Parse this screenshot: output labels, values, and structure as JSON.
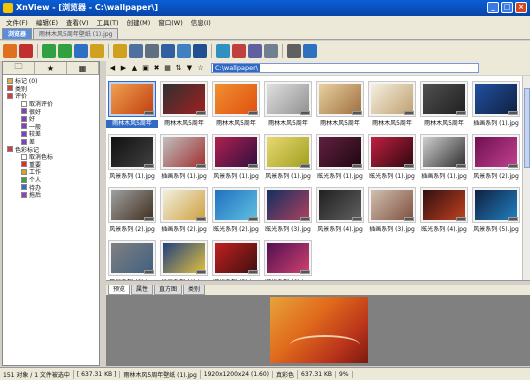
{
  "window": {
    "title": "XnView - [浏览器 - C:\\wallpaper\\]"
  },
  "menu": [
    "文件(F)",
    "编辑(E)",
    "查看(V)",
    "工具(T)",
    "创建(M)",
    "窗口(W)",
    "信息(I)"
  ],
  "tabs": [
    {
      "label": "浏览器"
    },
    {
      "label": "雨林木风5周年壁纸 (1).jpg"
    }
  ],
  "toolbar_icons": [
    "browse-icon",
    "fullscreen-icon",
    "refresh-icon",
    "forward-icon",
    "back-icon",
    "rotate-icon",
    "folder-icon",
    "copy-icon",
    "print-icon",
    "scan-icon",
    "mail-icon",
    "slideshow-icon",
    "web-icon",
    "capture-icon",
    "batch-icon",
    "convert-icon",
    "settings-icon",
    "help-icon"
  ],
  "path": {
    "value": "C:\\wallpaper\\"
  },
  "tree": [
    {
      "label": "标记 (0)",
      "indent": 1,
      "color": "#e0b040"
    },
    {
      "label": "类别",
      "indent": 1,
      "color": "#d04040"
    },
    {
      "label": "评价",
      "indent": 1,
      "color": "#d04040"
    },
    {
      "label": "取消评价",
      "indent": 2,
      "color": "#ffffff"
    },
    {
      "label": "很好",
      "indent": 2,
      "color": "#8040c0"
    },
    {
      "label": "好",
      "indent": 2,
      "color": "#8040c0"
    },
    {
      "label": "一般",
      "indent": 2,
      "color": "#8040c0"
    },
    {
      "label": "较差",
      "indent": 2,
      "color": "#8040c0"
    },
    {
      "label": "差",
      "indent": 2,
      "color": "#8040c0"
    },
    {
      "label": "色彩标记",
      "indent": 1,
      "color": "#d04040"
    },
    {
      "label": "取消色标",
      "indent": 2,
      "color": "#ffffff"
    },
    {
      "label": "重要",
      "indent": 2,
      "color": "#e03020"
    },
    {
      "label": "工作",
      "indent": 2,
      "color": "#e0a020"
    },
    {
      "label": "个人",
      "indent": 2,
      "color": "#40a040"
    },
    {
      "label": "待办",
      "indent": 2,
      "color": "#3070d0"
    },
    {
      "label": "拖后",
      "indent": 2,
      "color": "#9040c0"
    }
  ],
  "thumbnails": [
    {
      "caption": "雨林木风5周年",
      "colors": [
        "#f0a050",
        "#c04010"
      ]
    },
    {
      "caption": "雨林木风5周年",
      "colors": [
        "#303030",
        "#a02020"
      ]
    },
    {
      "caption": "雨林木风5周年",
      "colors": [
        "#f09030",
        "#e05010"
      ]
    },
    {
      "caption": "雨林木风5周年",
      "colors": [
        "#e0e0e0",
        "#909090"
      ]
    },
    {
      "caption": "雨林木风5周年",
      "colors": [
        "#e8d0a0",
        "#a07040"
      ]
    },
    {
      "caption": "雨林木风5周年",
      "colors": [
        "#f4f0e0",
        "#c0a070"
      ]
    },
    {
      "caption": "雨林木风5周年",
      "colors": [
        "#505050",
        "#202020"
      ]
    },
    {
      "caption": "插画系列 (1).jpg",
      "colors": [
        "#2050a0",
        "#102040"
      ]
    },
    {
      "caption": "风景系列 (1).jpg",
      "colors": [
        "#101010",
        "#404040"
      ]
    },
    {
      "caption": "插画系列 (1).jpg",
      "colors": [
        "#c0c0c0",
        "#a03030"
      ]
    },
    {
      "caption": "风景系列 (1).jpg",
      "colors": [
        "#b02050",
        "#301040"
      ]
    },
    {
      "caption": "风景系列 (1).jpg",
      "colors": [
        "#e8d870",
        "#a0a020"
      ]
    },
    {
      "caption": "眩光系列 (1).jpg",
      "colors": [
        "#602040",
        "#200810"
      ]
    },
    {
      "caption": "眩光系列 (1).jpg",
      "colors": [
        "#c02040",
        "#300810"
      ]
    },
    {
      "caption": "插画系列 (1).jpg",
      "colors": [
        "#d0d0d0",
        "#303030"
      ]
    },
    {
      "caption": "风景系列 (2).jpg",
      "colors": [
        "#701050",
        "#c04090"
      ]
    },
    {
      "caption": "风景系列 (2).jpg",
      "colors": [
        "#a0a0a0",
        "#403020"
      ]
    },
    {
      "caption": "插画系列 (2).jpg",
      "colors": [
        "#f0f0e0",
        "#d0a040"
      ]
    },
    {
      "caption": "眩光系列 (2).jpg",
      "colors": [
        "#2070c0",
        "#60c0e0"
      ]
    },
    {
      "caption": "眩光系列 (3).jpg",
      "colors": [
        "#103060",
        "#b04060"
      ]
    },
    {
      "caption": "风景系列 (4).jpg",
      "colors": [
        "#202020",
        "#606060"
      ]
    },
    {
      "caption": "插画系列 (3).jpg",
      "colors": [
        "#d0c0b0",
        "#805040"
      ]
    },
    {
      "caption": "眩光系列 (4).jpg",
      "colors": [
        "#301010",
        "#c04020"
      ]
    },
    {
      "caption": "风景系列 (5).jpg",
      "colors": [
        "#102040",
        "#2080c0"
      ]
    },
    {
      "caption": "风景系列 (6).jpg",
      "colors": [
        "#808080",
        "#406080"
      ]
    },
    {
      "caption": "插画系列 (4).jpg",
      "colors": [
        "#204080",
        "#e0c040"
      ]
    },
    {
      "caption": "眩光系列 (5).jpg",
      "colors": [
        "#c02020",
        "#401010"
      ]
    },
    {
      "caption": "眩光系列 (6).jpg",
      "colors": [
        "#501050",
        "#d04070"
      ]
    }
  ],
  "preview_tabs": [
    "预览",
    "属性",
    "直方图",
    "类别"
  ],
  "status": [
    "151 对象 / 1 文件被选中",
    "[ 637.31 KB ]",
    "雨林木风5周年壁纸 (1).jpg",
    "1920x1200x24 (1.60)",
    "真彩色",
    "637.31 KB",
    "9%"
  ]
}
